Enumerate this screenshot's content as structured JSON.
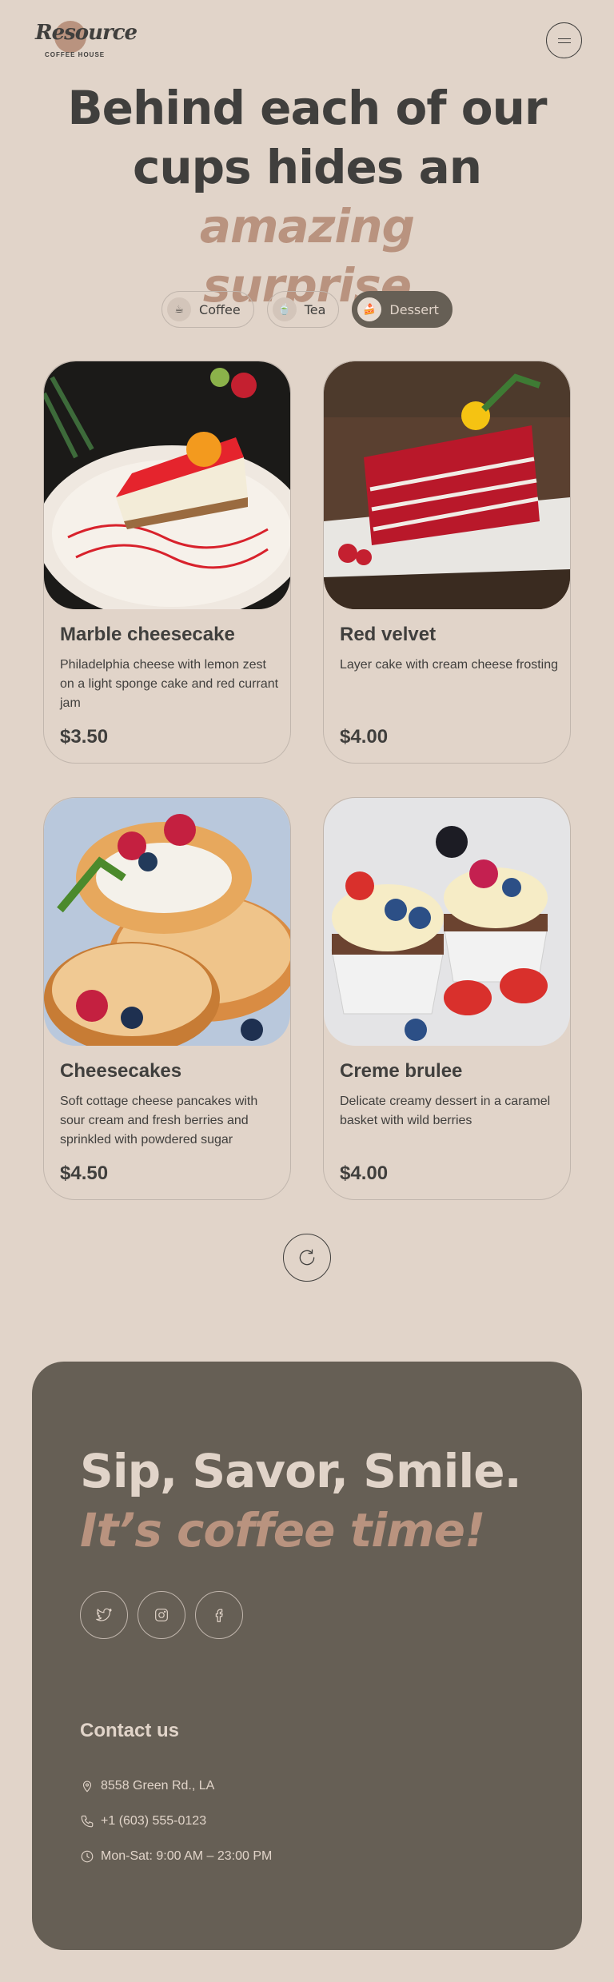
{
  "header": {
    "logo_word": "Resource",
    "logo_sub": "COFFEE HOUSE"
  },
  "hero": {
    "line1": "Behind each of our",
    "line2_plain": "cups hides an",
    "line2_accent": "amazing",
    "line3_accent": "surprise"
  },
  "tabs": [
    {
      "label": "Coffee",
      "icon": "coffee-cup-icon",
      "emoji": "☕",
      "active": false
    },
    {
      "label": "Tea",
      "icon": "tea-cup-icon",
      "emoji": "🍵",
      "active": false
    },
    {
      "label": "Dessert",
      "icon": "cake-icon",
      "emoji": "🍰",
      "active": true
    }
  ],
  "products": [
    {
      "title": "Marble cheesecake",
      "desc": "Philadelphia cheese with lemon zest on a light sponge cake and red currant jam",
      "price": "$3.50"
    },
    {
      "title": "Red velvet",
      "desc": "Layer cake with cream cheese frosting",
      "price": "$4.00"
    },
    {
      "title": "Cheesecakes",
      "desc": "Soft cottage cheese pancakes with sour cream and fresh berries and sprinkled with powdered sugar",
      "price": "$4.50"
    },
    {
      "title": "Creme brulee",
      "desc": "Delicate creamy dessert in a caramel basket with wild berries",
      "price": "$4.00"
    }
  ],
  "footer": {
    "line1": "Sip, Savor, Smile.",
    "line2": "It’s coffee time!",
    "socials": [
      "twitter-icon",
      "instagram-icon",
      "facebook-icon"
    ],
    "contact_title": "Contact us",
    "address": "8558 Green Rd.,  LA",
    "phone": "+1 (603) 555-0123",
    "hours": "Mon-Sat: 9:00 AM – 23:00 PM"
  },
  "colors": {
    "background": "#e1d4c9",
    "text_dark": "#403f3d",
    "accent": "#b9937f",
    "footer_bg": "#665f55"
  }
}
